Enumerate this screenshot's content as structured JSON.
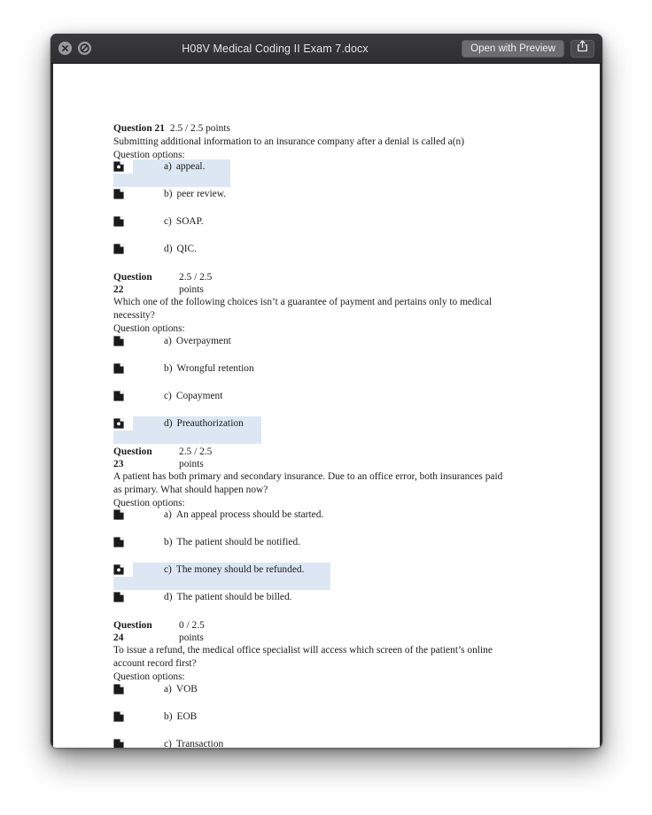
{
  "window": {
    "title": "H08V Medical Coding II Exam 7.docx",
    "close_icon": "close-circle-icon",
    "block_icon": "no-entry-circle-icon",
    "open_button_label": "Open with Preview",
    "share_icon": "share-arrow-up-icon",
    "titlebar_color": "#2f2f31",
    "highlight_color": "#dce7f3"
  },
  "document": {
    "options_label": "Question options:",
    "questions": [
      {
        "header_style": "inline",
        "number_word": "Question",
        "number_digits": "21",
        "number_inline": "Question 21",
        "points": "2.5 / 2.5 points",
        "points_value": "2.5 / 2.5",
        "points_word": "points",
        "text_lines": [
          "Submitting additional information to an insurance company after a denial is called a(n)"
        ],
        "options": [
          {
            "letter": "a)",
            "text": "appeal.",
            "selected": true,
            "highlight_width": 132
          },
          {
            "letter": "b)",
            "text": "peer review.",
            "selected": false,
            "highlight_width": 0
          },
          {
            "letter": "c)",
            "text": "SOAP.",
            "selected": false,
            "highlight_width": 0
          },
          {
            "letter": "d)",
            "text": "QIC.",
            "selected": false,
            "highlight_width": 0
          }
        ]
      },
      {
        "header_style": "wrapped",
        "number_word": "Question",
        "number_digits": "22",
        "number_inline": "Question 22",
        "points": "2.5 / 2.5 points",
        "points_value": "2.5 / 2.5",
        "points_word": "points",
        "text_lines": [
          "Which one of the following choices isn’t a guarantee of payment and pertains only to medical",
          "necessity?"
        ],
        "options": [
          {
            "letter": "a)",
            "text": "Overpayment",
            "selected": false,
            "highlight_width": 0
          },
          {
            "letter": "b)",
            "text": "Wrongful retention",
            "selected": false,
            "highlight_width": 0
          },
          {
            "letter": "c)",
            "text": "Copayment",
            "selected": false,
            "highlight_width": 0
          },
          {
            "letter": "d)",
            "text": "Preauthorization",
            "selected": true,
            "highlight_width": 167
          }
        ]
      },
      {
        "header_style": "wrapped",
        "number_word": "Question",
        "number_digits": "23",
        "number_inline": "Question 23",
        "points": "2.5 / 2.5 points",
        "points_value": "2.5 / 2.5",
        "points_word": "points",
        "text_lines": [
          "A patient has both primary and secondary insurance. Due to an office error, both insurances paid",
          "as primary. What should happen now?"
        ],
        "options": [
          {
            "letter": "a)",
            "text": "An appeal process should be started.",
            "selected": false,
            "highlight_width": 0
          },
          {
            "letter": "b)",
            "text": "The patient should be notified.",
            "selected": false,
            "highlight_width": 0
          },
          {
            "letter": "c)",
            "text": "The money should be refunded.",
            "selected": true,
            "highlight_width": 245
          },
          {
            "letter": "d)",
            "text": "The patient should be billed.",
            "selected": false,
            "highlight_width": 0
          }
        ]
      },
      {
        "header_style": "wrapped",
        "number_word": "Question",
        "number_digits": "24",
        "number_inline": "Question 24",
        "points": "0 / 2.5 points",
        "points_value": "0 / 2.5",
        "points_word": "points",
        "text_lines": [
          "To issue a refund, the medical office specialist will access which screen of the patient’s online",
          "account record first?"
        ],
        "options": [
          {
            "letter": "a)",
            "text": "VOB",
            "selected": false,
            "highlight_width": 0
          },
          {
            "letter": "b)",
            "text": "EOB",
            "selected": false,
            "highlight_width": 0
          },
          {
            "letter": "c)",
            "text": "Transaction",
            "selected": false,
            "highlight_width": 0
          }
        ]
      }
    ]
  }
}
